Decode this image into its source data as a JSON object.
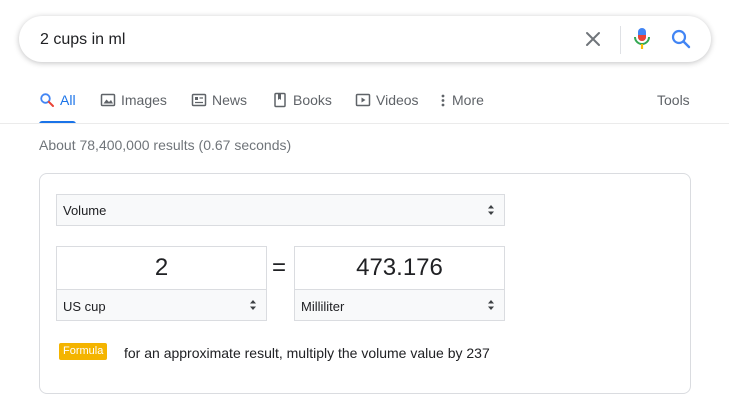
{
  "search": {
    "query": "2 cups in ml"
  },
  "icons": {
    "clear": "close-icon",
    "mic": "mic-icon",
    "search": "search-icon"
  },
  "tabs": [
    {
      "label": "All",
      "icon": "search-icon",
      "active": true
    },
    {
      "label": "Images",
      "icon": "image-icon",
      "active": false
    },
    {
      "label": "News",
      "icon": "news-icon",
      "active": false
    },
    {
      "label": "Books",
      "icon": "book-icon",
      "active": false
    },
    {
      "label": "Videos",
      "icon": "video-icon",
      "active": false
    },
    {
      "label": "More",
      "icon": "more-vert-icon",
      "active": false
    }
  ],
  "tools_label": "Tools",
  "result_stats": "About 78,400,000 results (0.67 seconds)",
  "converter": {
    "quantity": "Volume",
    "from_value": "2",
    "from_unit": "US cup",
    "equals": "=",
    "to_value": "473.176",
    "to_unit": "Milliliter",
    "formula_label": "Formula",
    "formula_text": "for an approximate result, multiply the volume value by 237"
  },
  "colors": {
    "accent_blue": "#1a73e8",
    "formula_badge": "#f4b400",
    "text_gray": "#5f6368"
  }
}
